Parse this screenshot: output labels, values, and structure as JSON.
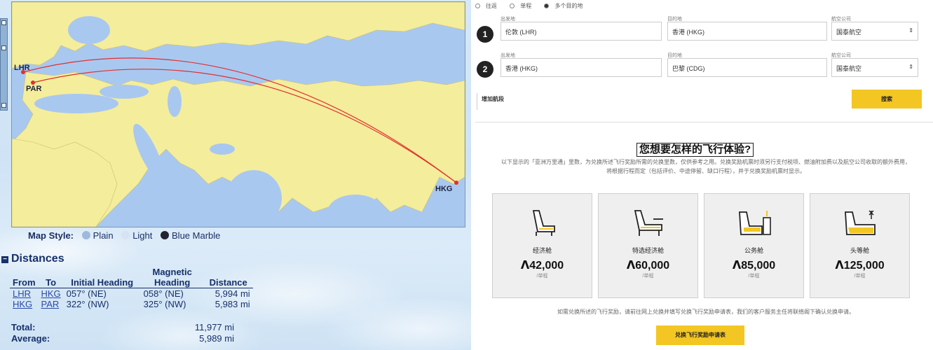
{
  "map": {
    "airports": [
      {
        "code": "LHR"
      },
      {
        "code": "PAR"
      },
      {
        "code": "HKG"
      }
    ],
    "style_label": "Map Style:",
    "styles": [
      "Plain",
      "Light",
      "Blue Marble"
    ]
  },
  "distances": {
    "title": "Distances",
    "headers": {
      "from": "From",
      "to": "To",
      "initial": "Initial Heading",
      "magnetic": "Magnetic Heading",
      "distance": "Distance"
    },
    "rows": [
      {
        "from": "LHR",
        "to": "HKG",
        "initial": "057°  (NE)",
        "magnetic": "058°  (NE)",
        "distance": "5,994 mi"
      },
      {
        "from": "HKG",
        "to": "PAR",
        "initial": "322°  (NW)",
        "magnetic": "325°  (NW)",
        "distance": "5,983 mi"
      }
    ],
    "total_label": "Total:",
    "total_value": "11,977 mi",
    "average_label": "Average:",
    "average_value": "5,989 mi"
  },
  "booking": {
    "trip_types": [
      "往返",
      "单程",
      "多个目的地"
    ],
    "selected_trip": 2,
    "segments": [
      {
        "num": "1",
        "origin_label": "出发地",
        "origin": "伦敦 (LHR)",
        "dest_label": "目的地",
        "dest": "香港 (HKG)",
        "airline_label": "航空公司",
        "airline": "国泰航空"
      },
      {
        "num": "2",
        "origin_label": "出发地",
        "origin": "香港 (HKG)",
        "dest_label": "目的地",
        "dest": "巴黎 (CDG)",
        "airline_label": "航空公司",
        "airline": "国泰航空"
      }
    ],
    "add_segment": "增加航段",
    "search": "搜索"
  },
  "experience": {
    "title": "您想要怎样的飞行体验?",
    "subtitle": "以下显示的「亚洲万里通」里数，为兑换所述飞行奖励所需的兑换里数，仅供参考之用。兑换奖励机票时须另行支付税项、燃油附加费以及航空公司收取的额外费用，将根据行程而定（包括评价、中途停留、缺口行程），并于兑换奖励机票时显示。",
    "cabins": [
      {
        "name": "经济舱",
        "points": "ᐱ42,000",
        "unit": "/单程"
      },
      {
        "name": "特选经济舱",
        "points": "ᐱ60,000",
        "unit": "/单程"
      },
      {
        "name": "公务舱",
        "points": "ᐱ85,000",
        "unit": "/单程"
      },
      {
        "name": "头等舱",
        "points": "ᐱ125,000",
        "unit": "/单程"
      }
    ],
    "note": "如需兑换所述的飞行奖励，请前往网上兑换并填写兑换飞行奖励申请表，我们的客户服务主任将联络阁下确认兑换申请。",
    "claim_button": "兑换飞行奖励申请表"
  },
  "colors": {
    "accent": "#f3c623",
    "route": "#e03030",
    "navy": "#16306a"
  }
}
